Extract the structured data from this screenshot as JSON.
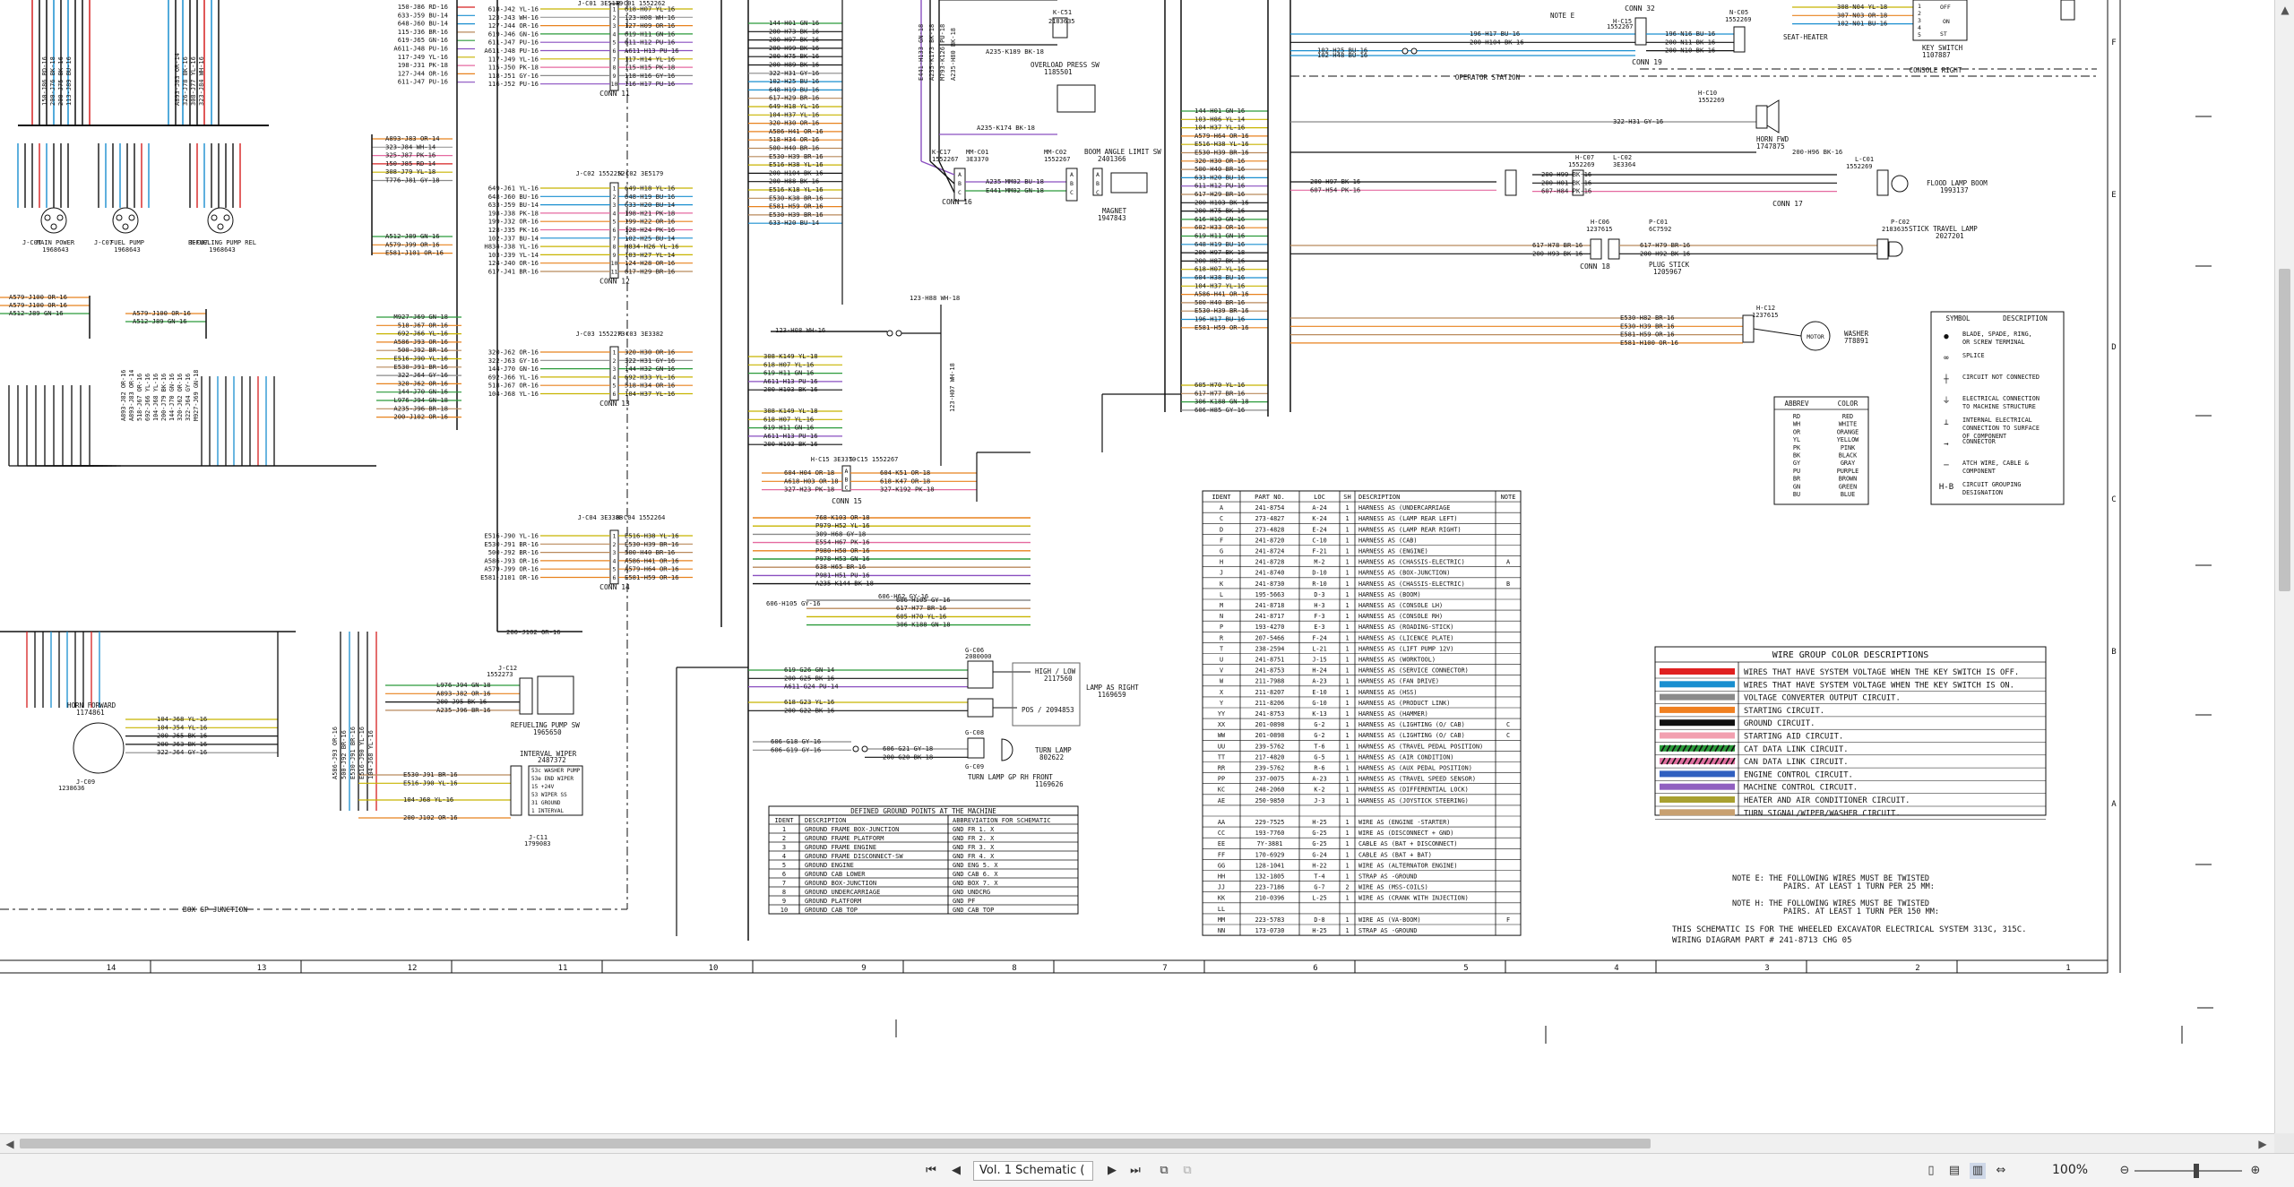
{
  "statusbar": {
    "view_select": "Vol. 1 Schematic (",
    "zoom": "100%",
    "first_icon": "first-page-icon",
    "prev_icon": "prev-page-icon",
    "next_icon": "next-page-icon",
    "last_icon": "last-page-icon"
  },
  "connectors": [
    {
      "name": "CONN 11",
      "id": "J-C01 3E5179 / H-C01 1552262"
    },
    {
      "name": "CONN 12",
      "id": "J-C02 1552252 / H-C02 3E5179"
    },
    {
      "name": "CONN 13",
      "id": "J-C03 1552273 / H-C03 3E3382"
    },
    {
      "name": "CONN 14",
      "id": "J-C04 3E3388 / H-C04 1552264"
    },
    {
      "name": "CONN 15",
      "id": "H-C15 3E3370 / S-C15 1552267"
    },
    {
      "name": "CONN 16",
      "id": "K-C17 1552267 / MM-C01 3E3370"
    },
    {
      "name": "CONN 17",
      "id": "L-C02 3E3364 / L-C01 1552269"
    },
    {
      "name": "CONN 18",
      "id": "H-C06 1237615"
    },
    {
      "name": "CONN 19",
      "id": "N-C05 1552269"
    },
    {
      "name": "CONN 32",
      "id": "H-C15 1552267"
    }
  ],
  "components": {
    "operator_station": "OPERATOR STATION",
    "console_right": "CONSOLE RIGHT",
    "seat_heater": "SEAT-HEATER",
    "key_switch": "KEY SWITCH",
    "key_switch_pn": "1107887",
    "horn_fwd": "HORN FWD",
    "horn_fwd_pn": "1747875",
    "flood_lamp": "FLOOD LAMP BOOM",
    "flood_lamp_pn": "1993137",
    "stick_lamp": "STICK TRAVEL LAMP",
    "stick_lamp_pn": "2027201",
    "plug_stick": "PLUG STICK",
    "plug_stick_pn": "1205967",
    "washer": "WASHER",
    "washer_pn": "7T8891",
    "motor": "MOTOR",
    "boom_angle": "BOOM ANGLE LIMIT SW",
    "boom_angle_pn": "2401366",
    "magnet": "MAGNET",
    "magnet_pn": "1947843",
    "overload": "OVERLOAD PRESS SW",
    "overload_pn": "1185501",
    "main_power": "MAIN POWER",
    "main_power_pn": "1968643",
    "fuel_pump": "FUEL PUMP",
    "fuel_pump_pn": "1968643",
    "refuel_relay": "REFUELING PUMP REL",
    "refuel_relay_pn": "1968643",
    "horn_forward": "HORN FORWARD",
    "horn_forward_pn": "1174861",
    "refuel_sw": "REFUELING PUMP SW",
    "refuel_sw_pn": "1965650",
    "interval_wiper": "INTERVAL WIPER",
    "interval_wiper_pn": "2487372",
    "wiper_c11": "J-C11",
    "wiper_c11_pn": "1799083",
    "box_gp": "BOX GP JUNCTION",
    "lamp_right": "LAMP AS RIGHT",
    "lamp_right_pn": "1169659",
    "high_low": "HIGH / LOW",
    "high_low_pn": "2117560",
    "pos": "POS / 2094853",
    "turn_lamp": "TURN LAMP",
    "turn_lamp_pn": "802622",
    "turn_lamp_front": "TURN LAMP GP RH FRONT",
    "turn_lamp_front_pn": "1169626",
    "note_e": "NOTE E"
  },
  "harness_table": {
    "headers": [
      "IDENT",
      "PART NO.",
      "LOC",
      "SH",
      "DESCRIPTION",
      "NOTE"
    ],
    "rows": [
      [
        "A",
        "241-8754",
        "A-24",
        "1",
        "HARNESS AS (UNDERCARRIAGE",
        ""
      ],
      [
        "C",
        "273-4827",
        "K-24",
        "1",
        "HARNESS AS (LAMP REAR LEFT)",
        ""
      ],
      [
        "D",
        "273-4828",
        "E-24",
        "1",
        "HARNESS AS (LAMP REAR RIGHT)",
        ""
      ],
      [
        "F",
        "241-8720",
        "C-10",
        "1",
        "HARNESS AS (CAB)",
        ""
      ],
      [
        "G",
        "241-8724",
        "F-21",
        "1",
        "HARNESS AS (ENGINE)",
        ""
      ],
      [
        "H",
        "241-8728",
        "M-2",
        "1",
        "HARNESS AS (CHASSIS-ELECTRIC)",
        "A"
      ],
      [
        "J",
        "241-8740",
        "D-10",
        "1",
        "HARNESS AS (BOX-JUNCTION)",
        ""
      ],
      [
        "K",
        "241-8730",
        "R-10",
        "1",
        "HARNESS AS (CHASSIS-ELECTRIC)",
        "B"
      ],
      [
        "L",
        "195-5663",
        "D-3",
        "1",
        "HARNESS AS (BOOM)",
        ""
      ],
      [
        "M",
        "241-8718",
        "H-3",
        "1",
        "HARNESS AS (CONSOLE LH)",
        ""
      ],
      [
        "N",
        "241-8717",
        "F-3",
        "1",
        "HARNESS AS (CONSOLE RH)",
        ""
      ],
      [
        "P",
        "193-4270",
        "E-3",
        "1",
        "HARNESS AS (ROADING-STICK)",
        ""
      ],
      [
        "R",
        "207-5466",
        "F-24",
        "1",
        "HARNESS AS (LICENCE PLATE)",
        ""
      ],
      [
        "T",
        "238-2594",
        "L-21",
        "1",
        "HARNESS AS (LIFT PUMP 12V)",
        ""
      ],
      [
        "U",
        "241-8751",
        "J-15",
        "1",
        "HARNESS AS (WORKTOOL)",
        ""
      ],
      [
        "V",
        "241-8753",
        "H-24",
        "1",
        "HARNESS AS (SERVICE CONNECTOR)",
        ""
      ],
      [
        "W",
        "211-7988",
        "A-23",
        "1",
        "HARNESS AS (FAN DRIVE)",
        ""
      ],
      [
        "X",
        "211-8207",
        "E-10",
        "1",
        "HARNESS AS (HSS)",
        ""
      ],
      [
        "Y",
        "211-8206",
        "G-10",
        "1",
        "HARNESS AS (PRODUCT LINK)",
        ""
      ],
      [
        "YY",
        "241-8753",
        "K-13",
        "1",
        "HARNESS AS (HAMMER)",
        ""
      ],
      [
        "XX",
        "201-0898",
        "G-2",
        "1",
        "HARNESS AS (LIGHTING (O/ CAB)",
        "C"
      ],
      [
        "WW",
        "201-0898",
        "G-2",
        "1",
        "HARNESS AS (LIGHTING (O/ CAB)",
        "C"
      ],
      [
        "UU",
        "239-5762",
        "T-6",
        "1",
        "HARNESS AS (TRAVEL PEDAL POSITION)",
        ""
      ],
      [
        "TT",
        "217-4820",
        "G-5",
        "1",
        "HARNESS AS (AIR CONDITION)",
        ""
      ],
      [
        "RR",
        "239-5762",
        "R-6",
        "1",
        "HARNESS AS (AUX PEDAL POSITION)",
        ""
      ],
      [
        "PP",
        "237-0075",
        "A-23",
        "1",
        "HARNESS AS (TRAVEL SPEED SENSOR)",
        ""
      ],
      [
        "KC",
        "248-2060",
        "K-2",
        "1",
        "HARNESS AS (DIFFERENTIAL LOCK)",
        ""
      ],
      [
        "AE",
        "250-9850",
        "J-3",
        "1",
        "HARNESS AS (JOYSTICK STEERING)",
        ""
      ],
      [
        "",
        "",
        "",
        "",
        "",
        ""
      ],
      [
        "AA",
        "229-7525",
        "H-25",
        "1",
        "WIRE AS (ENGINE -STARTER)",
        ""
      ],
      [
        "CC",
        "193-7760",
        "G-25",
        "1",
        "WIRE AS (DISCONNECT + GND)",
        ""
      ],
      [
        "EE",
        "7Y-3881",
        "G-25",
        "1",
        "CABLE AS (BAT + DISCONNECT)",
        ""
      ],
      [
        "FF",
        "170-6929",
        "G-24",
        "1",
        "CABLE AS (BAT + BAT)",
        ""
      ],
      [
        "GG",
        "128-1041",
        "H-22",
        "1",
        "WIRE AS (ALTERNATOR ENGINE)",
        ""
      ],
      [
        "HH",
        "132-1805",
        "T-4",
        "1",
        "STRAP AS -GROUND",
        ""
      ],
      [
        "JJ",
        "223-7186",
        "G-7",
        "2",
        "WIRE AS (MSS-COILS)",
        ""
      ],
      [
        "KK",
        "210-0396",
        "L-25",
        "1",
        "WIRE AS (CRANK WITH INJECTION)",
        ""
      ],
      [
        "LL",
        "",
        "",
        "",
        "",
        ""
      ],
      [
        "MM",
        "223-5783",
        "D-8",
        "1",
        "WIRE AS (VA-BOOM)",
        "F"
      ],
      [
        "NN",
        "173-0730",
        "H-25",
        "1",
        "STRAP AS -GROUND",
        ""
      ]
    ]
  },
  "ground_table": {
    "title": "DEFINED GROUND POINTS AT THE MACHINE",
    "headers": [
      "IDENT",
      "DESCRIPTION",
      "ABBREVIATION FOR SCHEMATIC"
    ],
    "rows": [
      [
        "1",
        "GROUND FRAME BOX-JUNCTION",
        "GND FR 1. X"
      ],
      [
        "2",
        "GROUND FRAME PLATFORM",
        "GND FR 2. X"
      ],
      [
        "3",
        "GROUND FRAME ENGINE",
        "GND FR 3. X"
      ],
      [
        "4",
        "GROUND FRAME DISCONNECT-SW",
        "GND FR 4. X"
      ],
      [
        "5",
        "GROUND ENGINE",
        "GND ENG 5. X"
      ],
      [
        "6",
        "GROUND CAB LOWER",
        "GND CAB 6. X"
      ],
      [
        "7",
        "GROUND BOX-JUNCTION",
        "GND BOX 7. X"
      ],
      [
        "8",
        "GROUND UNDERCARRIAGE",
        "GND UNDCRG"
      ],
      [
        "9",
        "GROUND PLATFORM",
        "GND PF"
      ],
      [
        "10",
        "GROUND CAB TOP",
        "GND CAB TOP"
      ]
    ]
  },
  "wire_colors": {
    "title": "WIRE GROUP COLOR DESCRIPTIONS",
    "items": [
      {
        "color": "#e02020",
        "stripe": "",
        "label": "WIRES THAT HAVE SYSTEM VOLTAGE WHEN THE KEY SWITCH IS OFF."
      },
      {
        "color": "#1a8fd0",
        "stripe": "",
        "label": "WIRES THAT HAVE SYSTEM VOLTAGE WHEN THE KEY SWITCH IS ON."
      },
      {
        "color": "#8a8a8a",
        "stripe": "",
        "label": "VOLTAGE CONVERTER OUTPUT CIRCUIT."
      },
      {
        "color": "#f08020",
        "stripe": "",
        "label": "STARTING CIRCUIT."
      },
      {
        "color": "#111111",
        "stripe": "",
        "label": "GROUND CIRCUIT."
      },
      {
        "color": "#f2a0b0",
        "stripe": "",
        "label": "STARTING AID CIRCUIT."
      },
      {
        "color": "#2a9a3a",
        "stripe": "#111111",
        "label": "CAT DATA LINK CIRCUIT."
      },
      {
        "color": "#e070a0",
        "stripe": "#111111",
        "label": "CAN DATA LINK CIRCUIT."
      },
      {
        "color": "#3060c0",
        "stripe": "",
        "label": "ENGINE CONTROL CIRCUIT."
      },
      {
        "color": "#9060c0",
        "stripe": "",
        "label": "MACHINE CONTROL CIRCUIT."
      },
      {
        "color": "#a8a030",
        "stripe": "",
        "label": "HEATER AND AIR CONDITIONER CIRCUIT."
      },
      {
        "color": "#c8a070",
        "stripe": "",
        "label": "TURN SIGNAL/WIPER/WASHER CIRCUIT."
      }
    ]
  },
  "symbols": {
    "headers": [
      "SYMBOL",
      "DESCRIPTION"
    ],
    "items": [
      "BLADE, SPADE, RING, OR SCREW TERMINAL",
      "SPLICE",
      "CIRCUIT NOT CONNECTED",
      "ELECTRICAL CONNECTION TO MACHINE STRUCTURE",
      "INTERNAL ELECTRICAL CONNECTION TO SURFACE OF COMPONENT",
      "CONNECTOR",
      "ATCH WIRE, CABLE & COMPONENT",
      "CIRCUIT GROUPING DESIGNATION"
    ]
  },
  "abbrev": {
    "headers": [
      "ABBREV",
      "COLOR"
    ],
    "items": [
      [
        "RD",
        "RED"
      ],
      [
        "WH",
        "WHITE"
      ],
      [
        "OR",
        "ORANGE"
      ],
      [
        "YL",
        "YELLOW"
      ],
      [
        "PK",
        "PINK"
      ],
      [
        "BK",
        "BLACK"
      ],
      [
        "GY",
        "GRAY"
      ],
      [
        "PU",
        "PURPLE"
      ],
      [
        "BR",
        "BROWN"
      ],
      [
        "GN",
        "GREEN"
      ],
      [
        "BU",
        "BLUE"
      ]
    ]
  },
  "notes": {
    "note_e": "NOTE E: THE FOLLOWING WIRES MUST BE TWISTED",
    "note_e2": "PAIRS. AT LEAST 1 TURN PER 25 MM:",
    "note_h": "NOTE H: THE FOLLOWING WIRES MUST BE TWISTED",
    "note_h2": "PAIRS. AT LEAST 1 TURN PER 150 MM:",
    "footer1": "THIS SCHEMATIC IS FOR THE WHEELED EXCAVATOR ELECTRICAL SYSTEM 313C, 315C.",
    "footer2": "WIRING DIAGRAM PART # 241-8713 CHG 05"
  },
  "grid_cols": [
    "14",
    "13",
    "12",
    "11",
    "10",
    "9",
    "8",
    "7",
    "6",
    "5",
    "4",
    "3",
    "2",
    "1"
  ],
  "grid_rows": [
    "F",
    "E",
    "D",
    "C",
    "B",
    "A"
  ],
  "wire_labels": {
    "c11_left": [
      "618-J42 YL-16",
      "123-J43 WH-16",
      "127-J44 OR-16",
      "619-J46 GN-16",
      "611-J47 PU-16",
      "A611-J48 PU-16",
      "117-J49 YL-16",
      "115-J50 PK-18",
      "118-J51 GY-16",
      "116-J52 PU-16"
    ],
    "c11_right": [
      "618-H07 YL-16",
      "123-H08 WH-16",
      "127-H09 OR-16",
      "619-H11 GN-16",
      "611-H12 PU-16",
      "A611-H13 PU-16",
      "117-H14 YL-16",
      "115-H15 PK-18",
      "118-H16 GY-16",
      "116-H17 PU-16"
    ],
    "c12_left": [
      "649-J61 YL-16",
      "648-J60 BU-16",
      "633-J59 BU-14",
      "198-J38 PK-18",
      "199-J32 OR-16",
      "128-J35 PK-16",
      "102-J37 BU-14",
      "H834-J38 YL-16",
      "103-J39 YL-14",
      "124-J40 OR-16",
      "617-J41 BR-16"
    ],
    "c12_right": [
      "649-H18 YL-16",
      "648-H19 BU-16",
      "633-H20 BU-14",
      "198-H21 PK-18",
      "199-H22 OR-16",
      "128-H24 PK-16",
      "102-H25 BU-14",
      "H834-H26 YL-16",
      "103-H27 YL-14",
      "124-H28 OR-16",
      "617-H29 BR-16"
    ],
    "c13_left": [
      "320-J62 OR-16",
      "322-J63 GY-16",
      "144-J70 GN-16",
      "692-J66 YL-16",
      "518-J67 OR-16",
      "104-J68 YL-16"
    ],
    "c13_right": [
      "320-H30 OR-16",
      "322-H31 GY-16",
      "144-H32 GN-16",
      "692-H33 YL-16",
      "518-H34 OR-16",
      "104-H37 YL-16"
    ],
    "c14_left": [
      "E516-J90 YL-16",
      "E530-J91 BR-16",
      "500-J92 BR-16",
      "A586-J93 OR-16",
      "A579-J99 OR-16",
      "E581-J101 OR-16"
    ],
    "c14_right": [
      "E516-H38 YL-16",
      "E530-H39 BR-16",
      "500-H40 BR-16",
      "A586-H41 OR-16",
      "A579-H64 OR-16",
      "E581-H59 OR-16"
    ],
    "mid_col": [
      "144-H01 GN-16",
      "200-H73 BK-16",
      "200-H97 BK-16",
      "200-H99 BK-16",
      "200-H75 BK-16",
      "200-H89 BK-16",
      "322-H31 GY-16",
      "102-H25 BU-16",
      "648-H19 BU-16",
      "617-H29 BR-16",
      "649-H18 YL-16",
      "104-H37 YL-16",
      "320-H30 OR-16",
      "A586-H41 OR-16",
      "518-H34 OR-16",
      "500-H40 BR-16",
      "E530-H39 BR-16",
      "E516-H38 YL-16",
      "200-H104 BK-16",
      "200-H88 BK-16",
      "E516-K18 YL-16",
      "E530-K38 BR-16",
      "E581-H59 OR-16",
      "E530-H39 BR-16",
      "633-H20 BU-14"
    ],
    "right_col": [
      "144-H01 GN-16",
      "103-H86 YL-14",
      "104-H37 YL-16",
      "A579-H64 OR-16",
      "E516-H38 YL-16",
      "E530-H39 BR-16",
      "320-H30 OR-16",
      "500-H40 BR-16",
      "633-H20 BU-16",
      "611-H12 PU-16",
      "617-H29 BR-16",
      "200-H103 BK-16",
      "200-H75 BK-16",
      "616-H10 GN-16",
      "602-H33 OR-16",
      "619-H11 GN-16",
      "648-H19 BU-16",
      "200-H97 BK-18",
      "200-H87 BK-16",
      "618-H07 YL-16",
      "604-H38 BU-16",
      "104-H37 YL-16",
      "A586-H41 OR-16",
      "500-H40 BR-16",
      "E530-H39 BR-16",
      "196-H17 BU-16",
      "E581-H59 OR-16"
    ],
    "right_col2": [
      "605-H70 YL-16",
      "617-H77 BR-16",
      "306-K188 GN-18",
      "606-H85 GY-16"
    ],
    "left_side": [
      "150-J86 RD-16",
      "633-J59 BU-14",
      "648-J60 BU-14",
      "115-J36 BR-16",
      "619-J65 GN-16",
      "A611-J48 PU-16",
      "117-J49 YL-16",
      "198-J31 PK-18",
      "127-J44 OR-16",
      "611-J47 PU-16"
    ],
    "left_mid": [
      "A893-J83 OR-14",
      "323-J84 WH-14",
      "325-J87 PK-16",
      "150-J85 RD-14",
      "308-J79 YL-18",
      "T776-J81 GY-18"
    ],
    "left_low": [
      "A512-J89 GN-16",
      "A579-J99 OR-16",
      "E581-J101 OR-16"
    ],
    "left_far": [
      "A579-J100 OR-16",
      "A579-J100 OR-16",
      "A512-J89 GN-16"
    ],
    "left_far2": [
      "A579-J100 OR-16",
      "A512-J89 GN-16"
    ],
    "box_left": [
      "M927-J69 GN-18",
      "518-J67 OR-16",
      "692-J66 YL-16",
      "A586-J93 OR-16",
      "500-J92 BR-16",
      "E516-J90 YL-16",
      "E530-J91 BR-16",
      "322-J64 GY-16",
      "320-J62 OR-16",
      "144-J70 GN-16",
      "L976-J94 GN-18",
      "A235-J96 BR-18",
      "200-J102 OR-16"
    ],
    "hbus_c15": [
      "604-H04 OR-18",
      "A618-H03 OR-18",
      "327-H23 PK-18"
    ],
    "hbus_c15r": [
      "604-K51 OR-18",
      "618-K47 OR-18",
      "327-K192 PK-18"
    ],
    "hbus_mid": [
      "768-K103 OR-18",
      "P979-H52 YL-16",
      "309-H68 GY-18",
      "E554-H67 PK-16",
      "P980-H50 OR-16",
      "P978-H53 GN-16",
      "638-H65 BR-16",
      "P981-H51 PU-16",
      "A235-K144 BK-18"
    ],
    "hbus_lo": [
      "606-H105 GY-16",
      "617-H77 BR-16",
      "605-H70 YL-16",
      "306-K188 GN-18"
    ],
    "lamp_wires": [
      "619-G26 GN-14",
      "200-G25 BK-16",
      "A611-G24 PU-14",
      "618-G23 YL-16",
      "200-G22 BK-16"
    ],
    "turn_wires": [
      "606-G18 GY-16",
      "606-G19 GY-16",
      "606-G21 GY-18",
      "200-G20 BK-18"
    ],
    "horn_wires": [
      "104-J68 YL-16",
      "104-J54 YL-16",
      "200-J65 BK-16",
      "200-J63 BK-16",
      "322-J64 GY-16"
    ],
    "refuel_wires": [
      "L976-J94 GN-18",
      "A893-J82 OR-16",
      "200-J95 BK-16",
      "A235-J96 BR-16"
    ],
    "wiper_wires": [
      "E530-J91 BR-16",
      "E516-J90 YL-16",
      "104-J68 YL-16",
      "200-J102 OR-16"
    ],
    "c16_wires": [
      "A235-MM02 BU-18",
      "E441-MM02 GN-18"
    ],
    "c15_top": [
      "308-K149 YL-18",
      "618-H07 YL-16",
      "619-H11 GN-16",
      "A611-H13 PU-16",
      "200-H103 BK-16"
    ],
    "c15_top2": [
      "308-K149 YL-18",
      "618-H07 YL-16",
      "619-H11 GN-16",
      "A611-H13 PU-16",
      "200-H103 BK-16"
    ],
    "mid_123": [
      "123-H88 WH-18",
      "123-H08 WH-16"
    ],
    "right_top": [
      "196-H17 BU-16",
      "200-H104 BK-16",
      "102-H25 BU-16",
      "102-H48 BU-16"
    ],
    "right_top2": [
      "196-N16 BU-16",
      "200-N11 BK-16",
      "200-N10 BK-16"
    ],
    "key_wires": [
      "308-N04 YL-18",
      "307-N03 OR-18",
      "102-N01 BU-16"
    ],
    "horn_fwd_w": [
      "322-H31 GY-16",
      "200-H96 BK-16"
    ],
    "flood_w": [
      "200-H97 BK-16",
      "607-H54 PK-16",
      "200-H99 BK-16",
      "200-H01 BK-16",
      "607-H84 PK-16"
    ],
    "stick_w": [
      "617-H78 BR-16",
      "200-H93 BK-16",
      "617-H79 BR-16",
      "200-H92 BK-16"
    ],
    "washer_w": [
      "E530-H82 BR-16",
      "E530-H39 BR-16",
      "E581-H59 OR-16",
      "E581-H100 OR-16"
    ]
  }
}
